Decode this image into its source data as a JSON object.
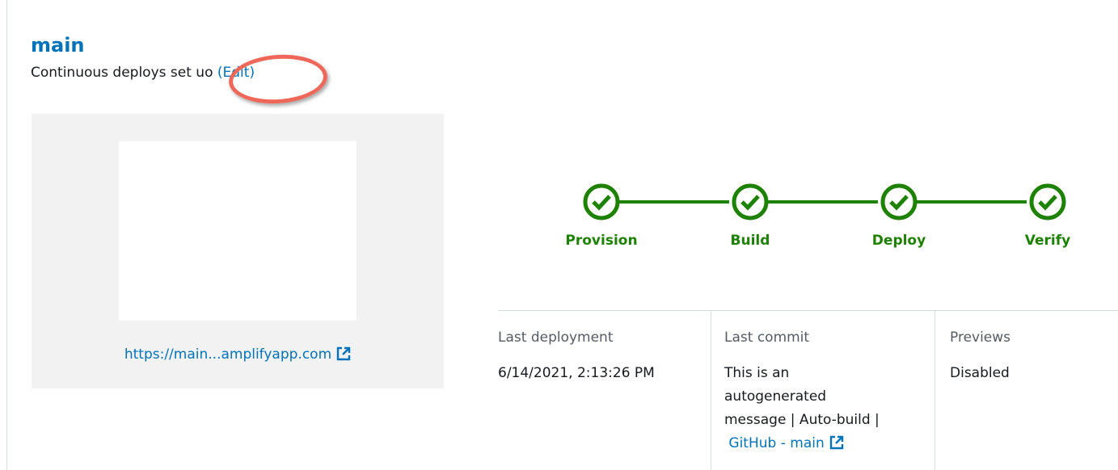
{
  "branch": {
    "name": "main",
    "subtitle_prefix": "Continuous deploys set u",
    "subtitle_partial": "o",
    "edit_label": "(Edit)"
  },
  "preview": {
    "url": "https://main...amplifyapp.com"
  },
  "pipeline": {
    "steps": [
      {
        "label": "Provision",
        "status": "success"
      },
      {
        "label": "Build",
        "status": "success"
      },
      {
        "label": "Deploy",
        "status": "success"
      },
      {
        "label": "Verify",
        "status": "success"
      }
    ],
    "success_color": "#1d8102"
  },
  "details": {
    "last_deployment": {
      "heading": "Last deployment",
      "value": "6/14/2021, 2:13:26 PM"
    },
    "last_commit": {
      "heading": "Last commit",
      "line1": "This is an",
      "line2": "autogenerated",
      "line3": "message | Auto-build |",
      "link": "GitHub - main"
    },
    "previews": {
      "heading": "Previews",
      "value": "Disabled"
    }
  },
  "colors": {
    "link": "#0073bb",
    "highlight": "#ef6759",
    "panel_bg": "#f2f2f2"
  },
  "icons": {
    "step": "check-circle-icon",
    "external": "external-link-icon"
  }
}
